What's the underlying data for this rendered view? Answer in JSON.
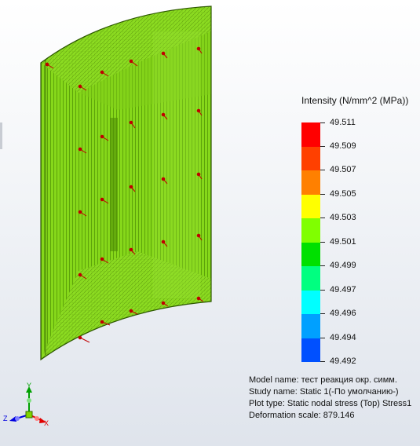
{
  "legend": {
    "title": "Intensity (N/mm^2 (MPa))",
    "levels": [
      {
        "label": "49.511",
        "color": "#ff0000"
      },
      {
        "label": "49.509",
        "color": "#ff4000"
      },
      {
        "label": "49.507",
        "color": "#ff8000"
      },
      {
        "label": "49.505",
        "color": "#ffff00"
      },
      {
        "label": "49.503",
        "color": "#80ff00"
      },
      {
        "label": "49.501",
        "color": "#00e000"
      },
      {
        "label": "49.499",
        "color": "#00ff80"
      },
      {
        "label": "49.497",
        "color": "#00ffff"
      },
      {
        "label": "49.496",
        "color": "#00a0ff"
      },
      {
        "label": "49.494",
        "color": "#0050ff"
      },
      {
        "label": "49.492",
        "color": "#0000ff"
      }
    ]
  },
  "study_info": {
    "model_name": "Model name: тест реакция окр. симм.",
    "study_name": "Study name: Static 1(-По умолчанию-)",
    "plot_type": "Plot type: Static nodal stress (Top) Stress1",
    "deformation_scale": "Deformation scale: 879.146"
  },
  "triad": {
    "x": "X",
    "y": "Y",
    "z": "Z"
  },
  "colors": {
    "surface": "#7fd400",
    "surface_edge": "#3b6e00",
    "arrow": "#c00000"
  }
}
